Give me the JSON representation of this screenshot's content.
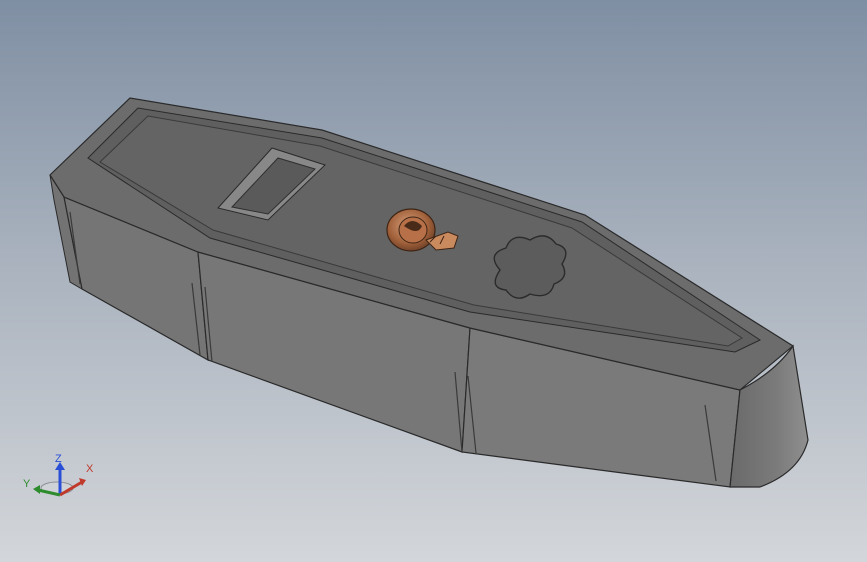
{
  "viewport": {
    "background_top": "#7f8fa3",
    "background_bottom": "#d3d6da"
  },
  "model": {
    "name": "coffin-part",
    "body_color": "#6f6f6f",
    "top_color": "#5e5e5e",
    "emblem_color": "#a8663a"
  },
  "triad": {
    "x_label": "X",
    "y_label": "Y",
    "z_label": "Z",
    "x_color": "#c0392b",
    "y_color": "#2e8b2e",
    "z_color": "#2a4fd6"
  }
}
